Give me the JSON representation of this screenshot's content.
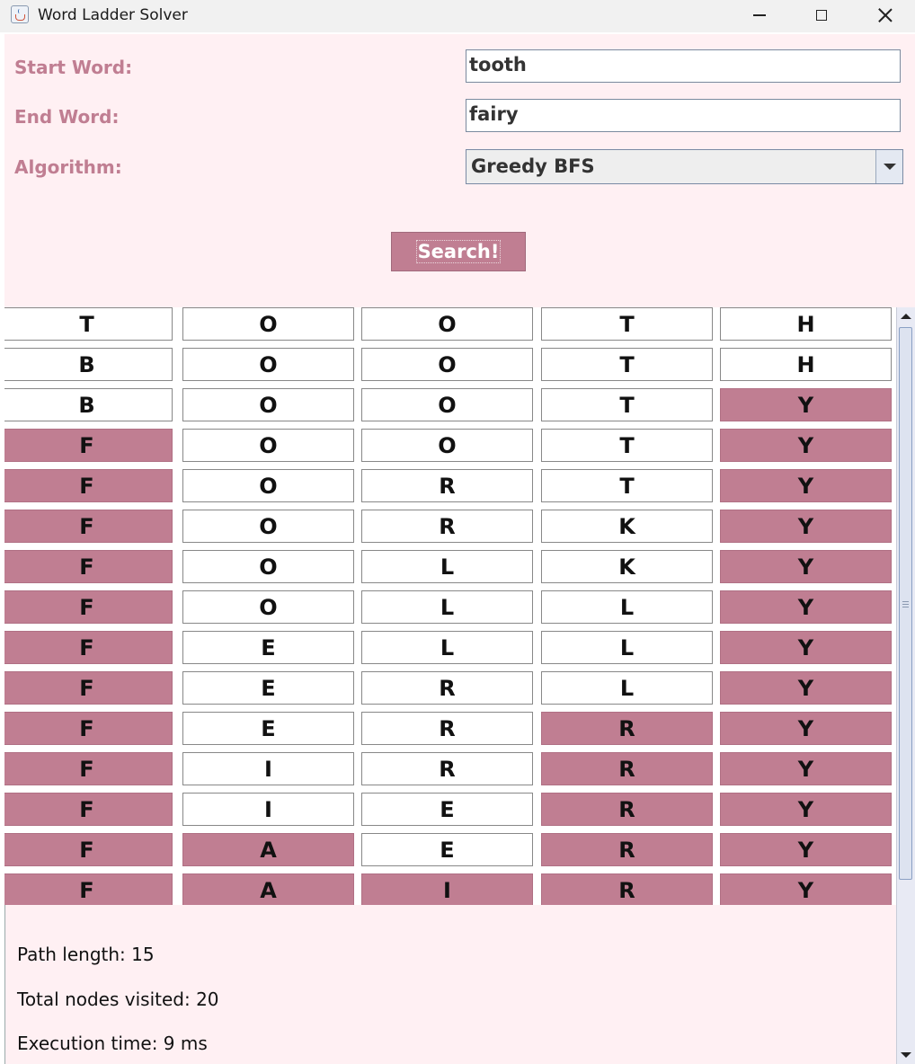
{
  "window": {
    "title": "Word Ladder Solver"
  },
  "form": {
    "start_label": "Start Word:",
    "start_value": "tooth",
    "end_label": "End Word:",
    "end_value": "fairy",
    "algorithm_label": "Algorithm:",
    "algorithm_value": "Greedy BFS",
    "search_label": "Search!"
  },
  "ladder": [
    {
      "letters": [
        "T",
        "O",
        "O",
        "T",
        "H"
      ],
      "matched": [
        false,
        false,
        false,
        false,
        false
      ]
    },
    {
      "letters": [
        "B",
        "O",
        "O",
        "T",
        "H"
      ],
      "matched": [
        false,
        false,
        false,
        false,
        false
      ]
    },
    {
      "letters": [
        "B",
        "O",
        "O",
        "T",
        "Y"
      ],
      "matched": [
        false,
        false,
        false,
        false,
        true
      ]
    },
    {
      "letters": [
        "F",
        "O",
        "O",
        "T",
        "Y"
      ],
      "matched": [
        true,
        false,
        false,
        false,
        true
      ]
    },
    {
      "letters": [
        "F",
        "O",
        "R",
        "T",
        "Y"
      ],
      "matched": [
        true,
        false,
        false,
        false,
        true
      ]
    },
    {
      "letters": [
        "F",
        "O",
        "R",
        "K",
        "Y"
      ],
      "matched": [
        true,
        false,
        false,
        false,
        true
      ]
    },
    {
      "letters": [
        "F",
        "O",
        "L",
        "K",
        "Y"
      ],
      "matched": [
        true,
        false,
        false,
        false,
        true
      ]
    },
    {
      "letters": [
        "F",
        "O",
        "L",
        "L",
        "Y"
      ],
      "matched": [
        true,
        false,
        false,
        false,
        true
      ]
    },
    {
      "letters": [
        "F",
        "E",
        "L",
        "L",
        "Y"
      ],
      "matched": [
        true,
        false,
        false,
        false,
        true
      ]
    },
    {
      "letters": [
        "F",
        "E",
        "R",
        "L",
        "Y"
      ],
      "matched": [
        true,
        false,
        false,
        false,
        true
      ]
    },
    {
      "letters": [
        "F",
        "E",
        "R",
        "R",
        "Y"
      ],
      "matched": [
        true,
        false,
        false,
        true,
        true
      ]
    },
    {
      "letters": [
        "F",
        "I",
        "R",
        "R",
        "Y"
      ],
      "matched": [
        true,
        false,
        false,
        true,
        true
      ]
    },
    {
      "letters": [
        "F",
        "I",
        "E",
        "R",
        "Y"
      ],
      "matched": [
        true,
        false,
        false,
        true,
        true
      ]
    },
    {
      "letters": [
        "F",
        "A",
        "E",
        "R",
        "Y"
      ],
      "matched": [
        true,
        true,
        false,
        true,
        true
      ]
    },
    {
      "letters": [
        "F",
        "A",
        "I",
        "R",
        "Y"
      ],
      "matched": [
        true,
        true,
        true,
        true,
        true
      ]
    }
  ],
  "stats": {
    "path_length": "Path length: 15",
    "nodes_visited": "Total nodes visited: 20",
    "execution_time": "Execution time: 9 ms"
  },
  "colors": {
    "accent": "#c07e92",
    "background": "#fff0f3",
    "label": "#c07e92"
  }
}
